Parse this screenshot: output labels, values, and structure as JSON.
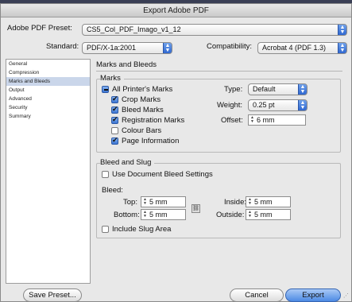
{
  "dialog": {
    "title": "Export Adobe PDF"
  },
  "preset": {
    "label": "Adobe PDF Preset:",
    "value": "CS5_Col_PDF_Imago_v1_12"
  },
  "standard": {
    "label": "Standard:",
    "value": "PDF/X-1a:2001"
  },
  "compatibility": {
    "label": "Compatibility:",
    "value": "Acrobat 4 (PDF 1.3)"
  },
  "sidebar": {
    "items": [
      {
        "label": "General"
      },
      {
        "label": "Compression"
      },
      {
        "label": "Marks and Bleeds"
      },
      {
        "label": "Output"
      },
      {
        "label": "Advanced"
      },
      {
        "label": "Security"
      },
      {
        "label": "Summary"
      }
    ],
    "selected": "Marks and Bleeds"
  },
  "panel": {
    "title": "Marks and Bleeds"
  },
  "marks": {
    "group_title": "Marks",
    "all_printers_marks": {
      "label": "All Printer's Marks",
      "state": "mixed"
    },
    "crop_marks": {
      "label": "Crop Marks",
      "checked": true
    },
    "bleed_marks": {
      "label": "Bleed Marks",
      "checked": true
    },
    "registration_marks": {
      "label": "Registration Marks",
      "checked": true
    },
    "colour_bars": {
      "label": "Colour Bars",
      "checked": false
    },
    "page_information": {
      "label": "Page Information",
      "checked": true
    },
    "type": {
      "label": "Type:",
      "value": "Default"
    },
    "weight": {
      "label": "Weight:",
      "value": "0.25 pt"
    },
    "offset": {
      "label": "Offset:",
      "value": "6 mm"
    }
  },
  "bleed_slug": {
    "group_title": "Bleed and Slug",
    "use_document_bleed": {
      "label": "Use Document Bleed Settings",
      "checked": false
    },
    "bleed_label": "Bleed:",
    "top": {
      "label": "Top:",
      "value": "5 mm"
    },
    "bottom": {
      "label": "Bottom:",
      "value": "5 mm"
    },
    "inside": {
      "label": "Inside:",
      "value": "5 mm"
    },
    "outside": {
      "label": "Outside:",
      "value": "5 mm"
    },
    "include_slug": {
      "label": "Include Slug Area",
      "checked": false
    }
  },
  "buttons": {
    "save_preset": "Save Preset...",
    "cancel": "Cancel",
    "export": "Export"
  },
  "colors": {
    "selection": "#cad6ea",
    "accent": "#4c8ae4",
    "window_bg": "#e8e8e8"
  }
}
